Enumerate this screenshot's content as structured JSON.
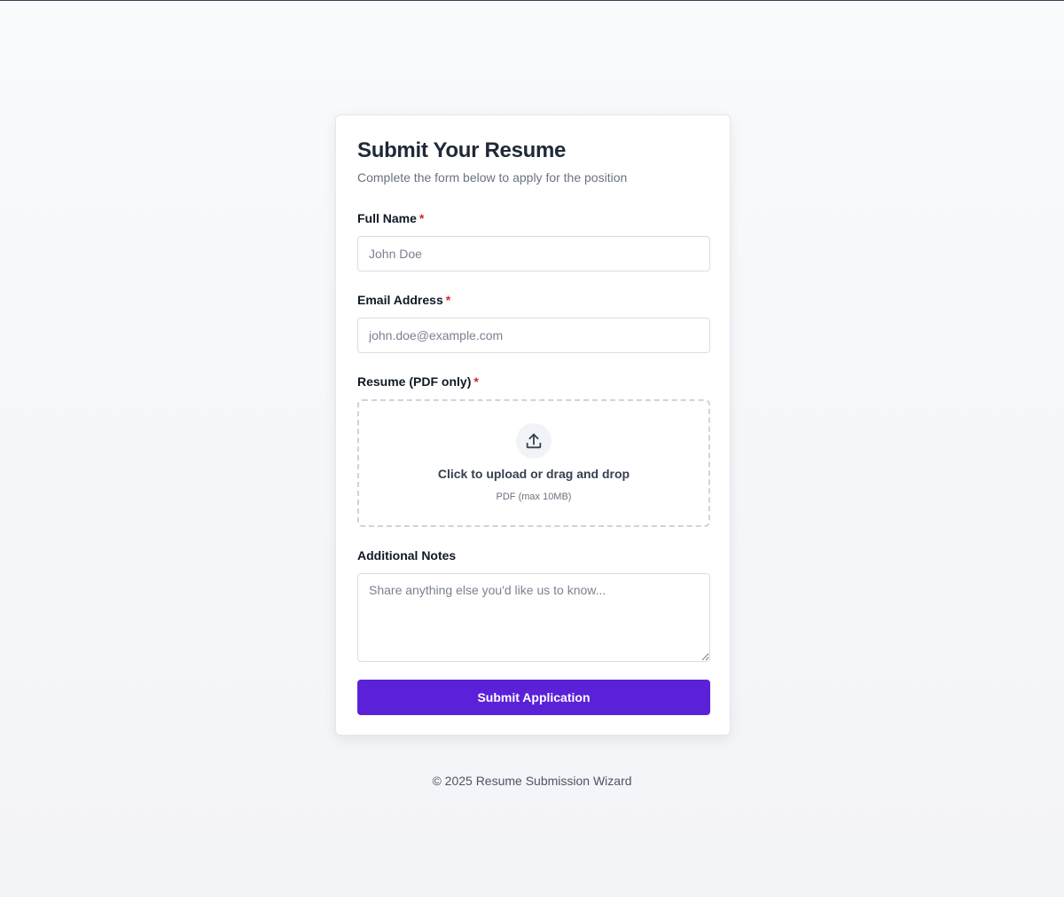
{
  "form": {
    "title": "Submit Your Resume",
    "subtitle": "Complete the form below to apply for the position",
    "required_marker": "*",
    "full_name": {
      "label": "Full Name",
      "placeholder": "John Doe",
      "value": ""
    },
    "email": {
      "label": "Email Address",
      "placeholder": "john.doe@example.com",
      "value": ""
    },
    "resume": {
      "label": "Resume (PDF only)",
      "upload_text": "Click to upload or drag and drop",
      "hint": "PDF (max 10MB)",
      "icon": "upload-icon"
    },
    "notes": {
      "label": "Additional Notes",
      "placeholder": "Share anything else you'd like us to know...",
      "value": ""
    },
    "submit_label": "Submit Application"
  },
  "footer": {
    "text": "© 2025 Resume Submission Wizard"
  },
  "colors": {
    "accent": "#5b21d9",
    "required": "#dc2626",
    "background": "#f8fafc",
    "card": "#ffffff"
  }
}
